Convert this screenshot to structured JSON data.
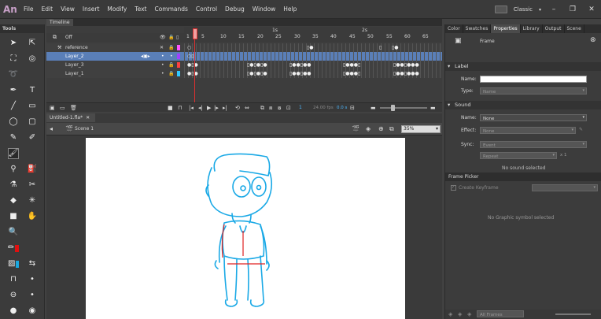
{
  "app": {
    "logo": "An"
  },
  "menu": [
    "File",
    "Edit",
    "View",
    "Insert",
    "Modify",
    "Text",
    "Commands",
    "Control",
    "Debug",
    "Window",
    "Help"
  ],
  "workspace": "Classic",
  "tools_panel": {
    "title": "Tools"
  },
  "timeline": {
    "tab": "Timeline",
    "onion_label": "Off",
    "ruler": [
      "1",
      "5",
      "10",
      "15",
      "20",
      "25",
      "30",
      "35",
      "40",
      "45",
      "50",
      "55",
      "60",
      "65"
    ],
    "seconds": [
      "1s",
      "2s"
    ],
    "layers": [
      {
        "name": "reference"
      },
      {
        "name": "Layer_2"
      },
      {
        "name": "Layer_3"
      },
      {
        "name": "Layer_1"
      }
    ],
    "frame": "1",
    "fps": "24.00 fps",
    "time": "0.0 s"
  },
  "document": {
    "tab": "Untitled-1.fla*",
    "scene": "Scene 1",
    "zoom": "35%"
  },
  "properties": {
    "tabs": [
      "Color",
      "Swatches",
      "Properties",
      "Library",
      "Output",
      "Scene"
    ],
    "type": "Frame",
    "label_section": "Label",
    "name_label": "Name:",
    "type_label": "Type:",
    "type_value": "Name",
    "sound_section": "Sound",
    "sound_name_label": "Name:",
    "sound_name_value": "None",
    "effect_label": "Effect:",
    "effect_value": "None",
    "sync_label": "Sync:",
    "sync_value": "Event",
    "repeat_value": "Repeat",
    "repeat_count": "x 1",
    "no_sound": "No sound selected"
  },
  "frame_picker": {
    "title": "Frame Picker",
    "create_keyframe": "Create Keyframe",
    "empty_msg": "No Graphic symbol selected",
    "all_frames": "All Frames"
  },
  "colors": {
    "stroke": "#e01010",
    "fill": "#19a8e0"
  }
}
